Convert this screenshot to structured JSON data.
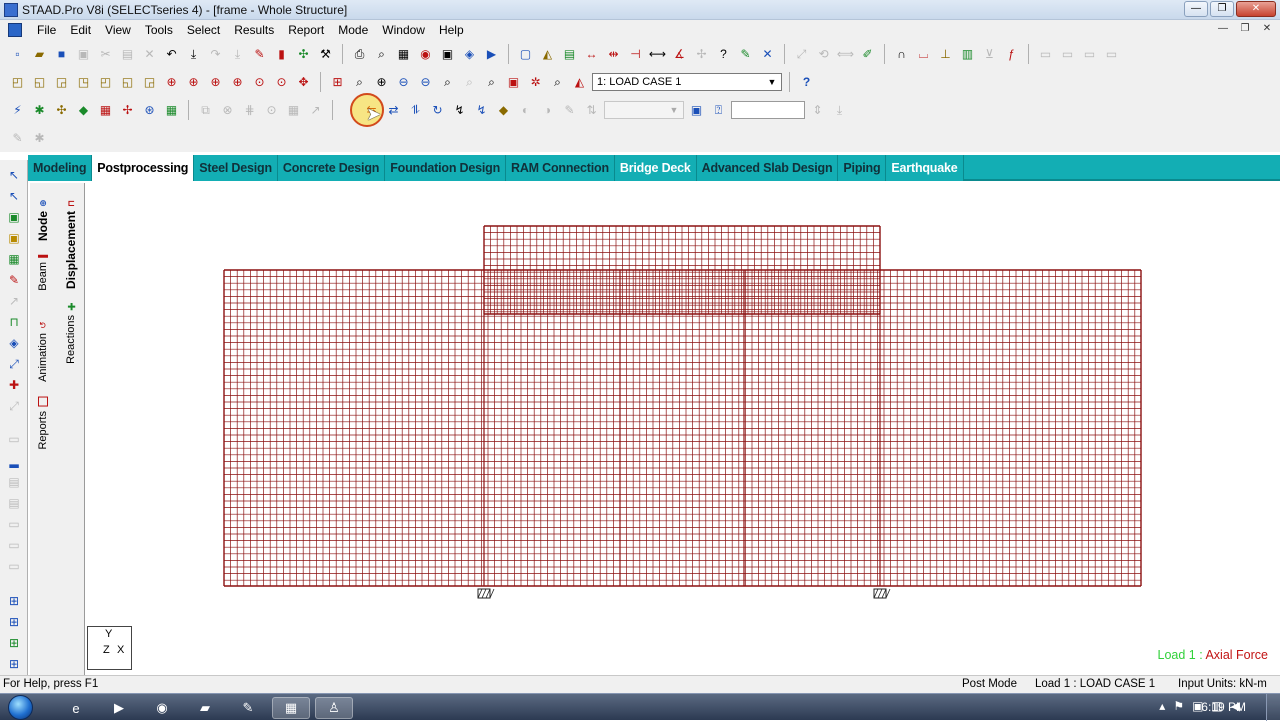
{
  "window": {
    "title": "STAAD.Pro V8i (SELECTseries 4) - [frame - Whole Structure]",
    "controls": [
      "—",
      "❐",
      "✕"
    ]
  },
  "menu": [
    "File",
    "Edit",
    "View",
    "Tools",
    "Select",
    "Results",
    "Report",
    "Mode",
    "Window",
    "Help"
  ],
  "mdi_controls": [
    "—",
    "❐",
    "✕"
  ],
  "toolbar": {
    "load_case": "1: LOAD CASE 1",
    "help_icon": "?",
    "dropdown2_value": "",
    "text_input_value": "",
    "dropdown_arrow": "▼"
  },
  "tabs": [
    "Modeling",
    "Postprocessing",
    "Steel Design",
    "Concrete Design",
    "Foundation Design",
    "RAM Connection",
    "Bridge Deck",
    "Advanced Slab Design",
    "Piping",
    "Earthquake"
  ],
  "active_tab": "Postprocessing",
  "page_control": {
    "left": [
      "Node",
      "Beam",
      "Animation",
      "Reports"
    ],
    "right": [
      "Displacement",
      "Reactions"
    ]
  },
  "canvas": {
    "axis": {
      "y": "Y",
      "z": "Z",
      "x": "X"
    },
    "load_label": {
      "prefix": "Load 1 : ",
      "suffix": "Axial Force"
    },
    "grid_color": "#8b1111"
  },
  "status": {
    "help": "For Help, press F1",
    "mode": "Post Mode",
    "load": "Load 1 : LOAD CASE 1",
    "units": "Input Units:  kN-m"
  },
  "taskbar": {
    "clock": "6:19 PM"
  }
}
